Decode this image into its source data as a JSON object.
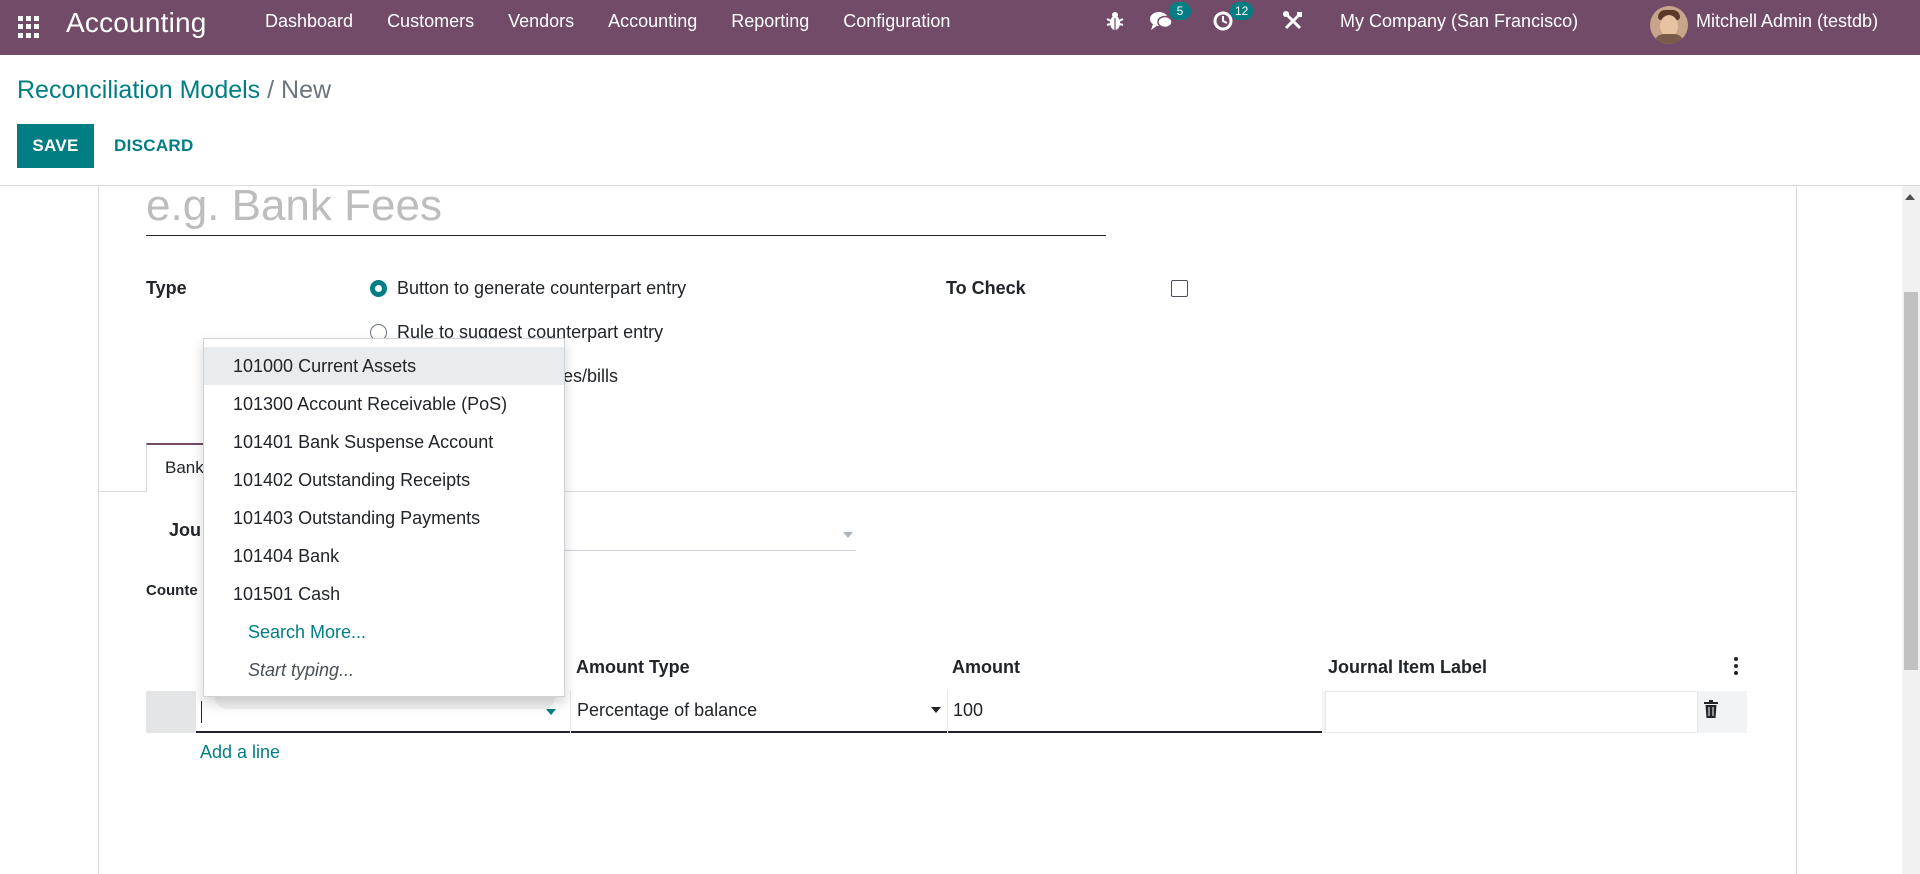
{
  "navbar": {
    "brand": "Accounting",
    "menu": [
      "Dashboard",
      "Customers",
      "Vendors",
      "Accounting",
      "Reporting",
      "Configuration"
    ],
    "messages_count": "5",
    "activities_count": "12",
    "company": "My Company (San Francisco)",
    "user": "Mitchell Admin (testdb)",
    "icons": [
      "apps-grid-icon",
      "bug-icon",
      "chat-icon",
      "clock-icon",
      "tools-icon"
    ]
  },
  "breadcrumb": {
    "parent": "Reconciliation Models",
    "separator": "/",
    "current": "New"
  },
  "toolbar": {
    "save_label": "SAVE",
    "discard_label": "DISCARD"
  },
  "form": {
    "name_placeholder": "e.g. Bank Fees",
    "type_label": "Type",
    "type_options": [
      {
        "label": "Button to generate counterpart entry",
        "checked": true
      },
      {
        "label": "Rule to suggest counterpart entry",
        "checked": false
      },
      {
        "label": "ces/bills",
        "checked": false
      }
    ],
    "to_check_label": "To Check",
    "to_check_value": false,
    "tab_label": "Bank",
    "journals_label": "Jou",
    "counterpart_label": "Counte"
  },
  "lines_table": {
    "headers": {
      "amount_type": "Amount Type",
      "amount": "Amount",
      "journal_item_label": "Journal Item Label"
    },
    "row": {
      "account": "",
      "amount_type": "Percentage of balance",
      "amount": "100",
      "label": ""
    },
    "add_line_label": "Add a line"
  },
  "dropdown": {
    "options": [
      "101000 Current Assets",
      "101300 Account Receivable (PoS)",
      "101401 Bank Suspense Account",
      "101402 Outstanding Receipts",
      "101403 Outstanding Payments",
      "101404 Bank",
      "101501 Cash"
    ],
    "search_more": "Search More...",
    "start_typing": "Start typing..."
  },
  "colors": {
    "navbar": "#714b67",
    "primary": "#017e84",
    "badge": "#017e84"
  }
}
